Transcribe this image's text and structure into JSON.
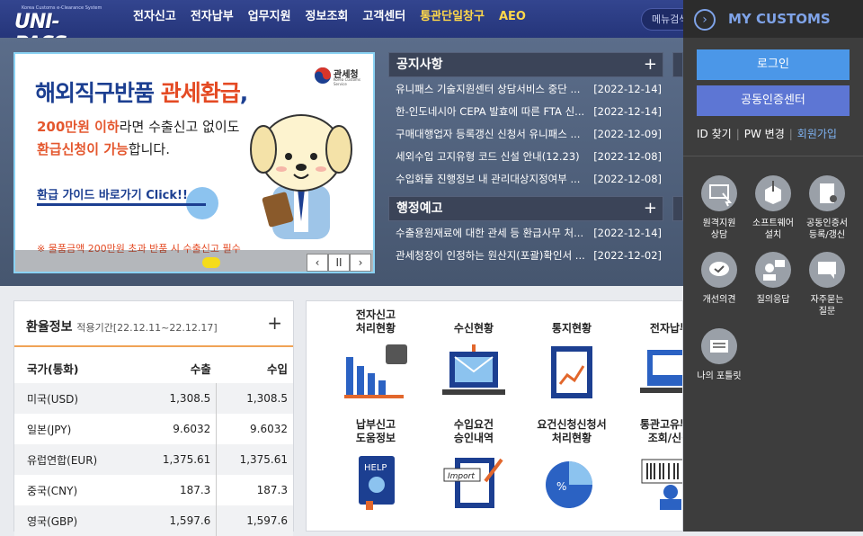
{
  "header": {
    "logo_small": "Korea Customs e-Clearance System",
    "logo_text": "UNI-PASS",
    "nav": [
      "전자신고",
      "전자납부",
      "업무지원",
      "정보조회",
      "고객센터",
      "통관단일창구",
      "AEO"
    ],
    "search_label": "메뉴검색"
  },
  "banner": {
    "title_prefix": "해외직구반품 ",
    "title_highlight": "관세환급",
    "title_suffix": ",",
    "line2_orange": "200만원 이하",
    "line2_rest": "라면 수출신고 없이도",
    "line3_orange": "환급신청이 가능",
    "line3_rest": "합니다.",
    "guide": "환급 가이드 바로가기 Click!!",
    "note": "※ 물품금액 200만원 초과 반품 시 수출신고 필수",
    "seal_title": "관세청",
    "seal_sub": "Korea Customs Service",
    "controls": [
      "‹",
      "II",
      "›"
    ]
  },
  "notices": {
    "title": "공지사항",
    "plus": "+",
    "items": [
      {
        "title": "유니패스 기술지원센터 상담서비스 중단 ...",
        "date": "[2022-12-14]"
      },
      {
        "title": "한-인도네시아 CEPA 발효에 따른 FTA 신...",
        "date": "[2022-12-14]"
      },
      {
        "title": "구매대행업자 등록갱신 신청서 유니패스 ...",
        "date": "[2022-12-09]"
      },
      {
        "title": "세외수입 고지유형 코드 신설 안내(12.23)",
        "date": "[2022-12-08]"
      },
      {
        "title": "수입화물 진행정보 내 관리대상지정여부 ...",
        "date": "[2022-12-08]"
      }
    ]
  },
  "preannounce": {
    "title": "행정예고",
    "plus": "+",
    "items": [
      {
        "title": "수출용원재료에 대한 관세 등 환급사무 처...",
        "date": "[2022-12-14]"
      },
      {
        "title": "관세청장이 인정하는 원산지(포괄)확인서 ...",
        "date": "[2022-12-02]"
      }
    ]
  },
  "exchange": {
    "title": "환율정보",
    "period": "적용기간[22.12.11~22.12.17]",
    "plus": "+",
    "columns": [
      "국가(통화)",
      "수출",
      "수입"
    ],
    "rows": [
      [
        "미국(USD)",
        "1,308.5",
        "1,308.5"
      ],
      [
        "일본(JPY)",
        "9.6032",
        "9.6032"
      ],
      [
        "유럽연합(EUR)",
        "1,375.61",
        "1,375.61"
      ],
      [
        "중국(CNY)",
        "187.3",
        "187.3"
      ],
      [
        "영국(GBP)",
        "1,597.6",
        "1,597.6"
      ]
    ]
  },
  "services": {
    "row1": [
      "전자신고\n처리현황",
      "수신현황",
      "통지현황",
      "전자납부"
    ],
    "row2": [
      "납부신고\n도움정보",
      "수입요건\n승인내역",
      "요건신청신청서\n처리현황",
      "통관고유부호\n조회/신청"
    ]
  },
  "panel": {
    "title": "MY CUSTOMS",
    "login": "로그인",
    "cert": "공동인증센터",
    "find_id": "ID 찾기",
    "pw": "PW 변경",
    "join": "회원가입",
    "sep": "|",
    "items": [
      "원격지원\n상담",
      "소프트웨어\n설치",
      "공동인증서\n등록/갱신",
      "개선의견",
      "질의응답",
      "자주묻는\n질문",
      "나의 포틀릿"
    ]
  },
  "colors": {
    "nav_bg": "#2b3c85",
    "accent": "#ffd84a",
    "panel_bg": "#3d3d3d",
    "login": "#4b97e8",
    "cert": "#5d76d4",
    "orange": "#e44a23"
  }
}
